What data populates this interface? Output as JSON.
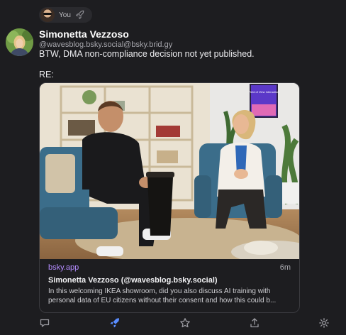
{
  "boost": {
    "label": "You",
    "avatar_icon": "user-avatar",
    "icon": "rocket-icon"
  },
  "post": {
    "author_name": "Simonetta Vezzoso",
    "author_handle": "@wavesblog.bsky.social@bsky.brid.gy",
    "text": "BTW, DMA non-compliance decision not yet published.",
    "re": "RE:"
  },
  "card": {
    "domain": "bsky.app",
    "time": "6m",
    "title": "Simonetta Vezzoso (@wavesblog.bsky.social)",
    "desc_line1": "In this welcoming IKEA showroom, did you also discuss AI training with",
    "desc_line2": "personal data of EU citizens without their consent and how this could b...",
    "screen_text": "Field of View Interaction"
  },
  "actions": {
    "reply": "reply-icon",
    "boost": "rocket-icon",
    "favourite": "star-icon",
    "share": "share-icon",
    "more": "settings-icon"
  },
  "colors": {
    "background": "#1d1d20",
    "accent": "#5a8dff",
    "link": "#b48cff"
  }
}
